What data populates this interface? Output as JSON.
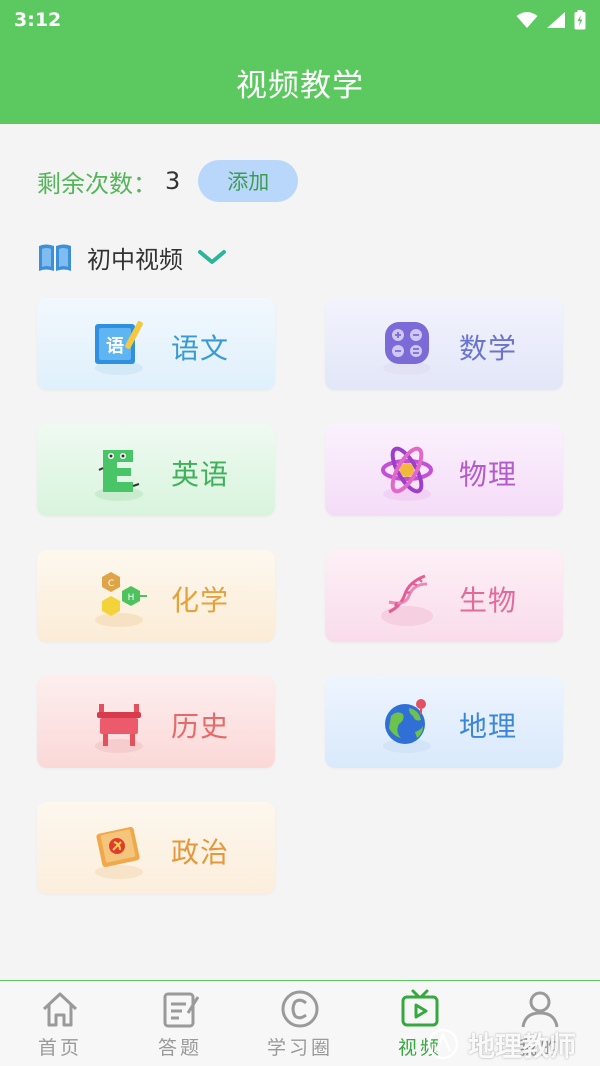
{
  "status": {
    "time": "3:12"
  },
  "header": {
    "title": "视频教学"
  },
  "remaining": {
    "label": "剩余次数：",
    "count": "3",
    "add_label": "添加"
  },
  "level_selector": {
    "label": "初中视频"
  },
  "subjects": [
    {
      "label": "语文",
      "icon": "chinese-book-icon",
      "text_color": "#3a9bd0"
    },
    {
      "label": "数学",
      "icon": "calculator-icon",
      "text_color": "#6b73d1"
    },
    {
      "label": "英语",
      "icon": "english-letter-icon",
      "text_color": "#3db25a"
    },
    {
      "label": "物理",
      "icon": "atom-icon",
      "text_color": "#b45acb"
    },
    {
      "label": "化学",
      "icon": "molecule-icon",
      "text_color": "#e5a13a"
    },
    {
      "label": "生物",
      "icon": "dna-icon",
      "text_color": "#e36b9c"
    },
    {
      "label": "历史",
      "icon": "bronze-vessel-icon",
      "text_color": "#e66a6a"
    },
    {
      "label": "地理",
      "icon": "globe-icon",
      "text_color": "#3d86d8"
    },
    {
      "label": "政治",
      "icon": "party-book-icon",
      "text_color": "#e5983a"
    }
  ],
  "tabs": [
    {
      "label": "首页",
      "icon": "home-icon"
    },
    {
      "label": "答题",
      "icon": "quiz-icon"
    },
    {
      "label": "学习圈",
      "icon": "copyright-circle-icon"
    },
    {
      "label": "视频",
      "icon": "tv-icon"
    },
    {
      "label": "我的",
      "icon": "person-icon"
    }
  ],
  "watermark": {
    "text": "地理教师"
  }
}
